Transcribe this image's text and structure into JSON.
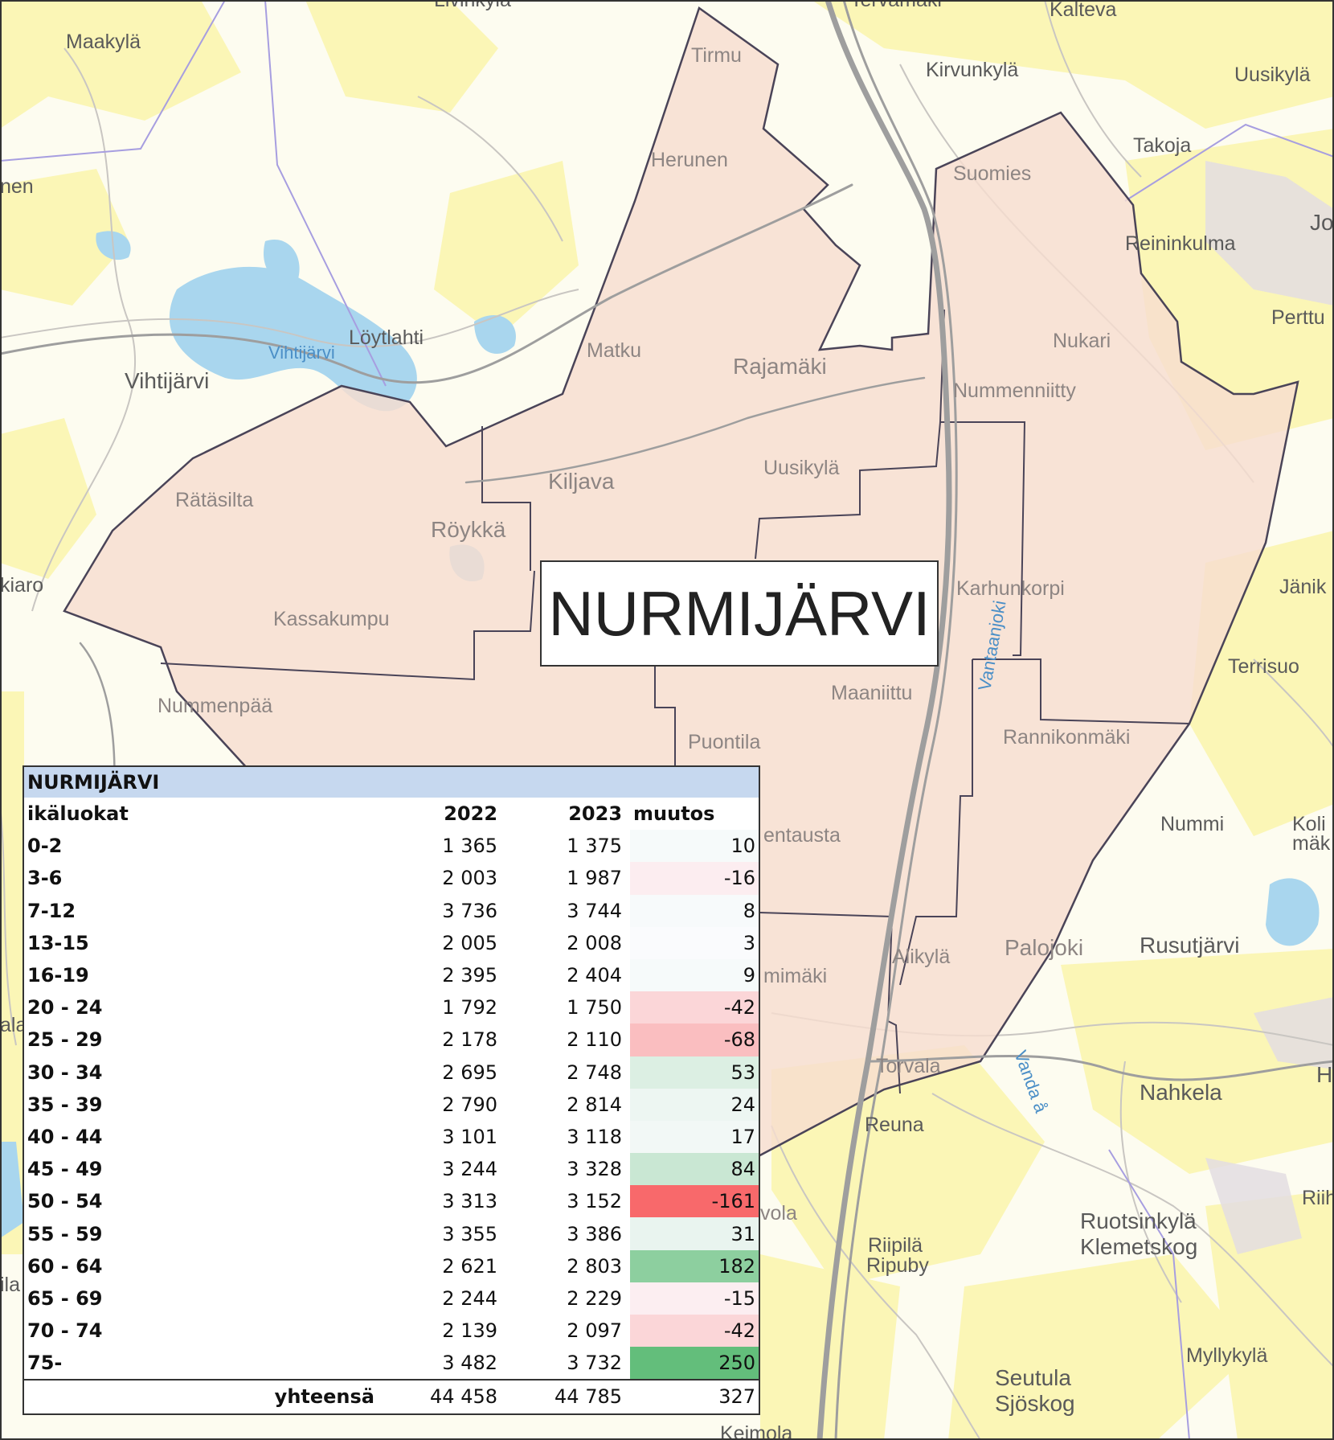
{
  "map": {
    "colors": {
      "land": "#fdfcf0",
      "open_field": "#fbf6b6",
      "water": "#a9d6ee",
      "urban": "#e3dde2",
      "road_major": "#9e9e9e",
      "region_fill": "#f6ddd0",
      "region_border": "#4a4458",
      "admin_border": "#a79ee0"
    },
    "places": [
      {
        "name": "Maakylä"
      },
      {
        "name": "Livinkylä"
      },
      {
        "name": "Tervamäki"
      },
      {
        "name": "Kalteva"
      },
      {
        "name": "Kirvunkylä"
      },
      {
        "name": "Uusikylä"
      },
      {
        "name": "Takoja"
      },
      {
        "name": "nen"
      },
      {
        "name": "Tirmu"
      },
      {
        "name": "Herunen"
      },
      {
        "name": "Suomies"
      },
      {
        "name": "Reininkulma"
      },
      {
        "name": "Jo"
      },
      {
        "name": "Perttu"
      },
      {
        "name": "Löytlahti"
      },
      {
        "name": "Vihtijärvi"
      },
      {
        "name": "Matku"
      },
      {
        "name": "Rajamäki"
      },
      {
        "name": "Nukari"
      },
      {
        "name": "Nummenniitty"
      },
      {
        "name": "Uusikylä"
      },
      {
        "name": "Kiljava"
      },
      {
        "name": "Rätäsilta"
      },
      {
        "name": "Röykkä"
      },
      {
        "name": "kiaro"
      },
      {
        "name": "Karhunkorpi"
      },
      {
        "name": "Jänik"
      },
      {
        "name": "Kassakumpu"
      },
      {
        "name": "Terrisuo"
      },
      {
        "name": "Nummenpää"
      },
      {
        "name": "Maaniittu"
      },
      {
        "name": "Puontila"
      },
      {
        "name": "Rannikonmäki"
      },
      {
        "name": "Nummi"
      },
      {
        "name": "Koli"
      },
      {
        "name": "mäk"
      },
      {
        "name": "entausta"
      },
      {
        "name": "mimäki"
      },
      {
        "name": "Alikylä"
      },
      {
        "name": "Palojoki"
      },
      {
        "name": "Rusutjärvi"
      },
      {
        "name": "Torvala"
      },
      {
        "name": "H"
      },
      {
        "name": "Nahkela"
      },
      {
        "name": "Reuna"
      },
      {
        "name": "Riih"
      },
      {
        "name": "vola"
      },
      {
        "name": "Riipilä"
      },
      {
        "name": "Ripuby"
      },
      {
        "name": "Ruotsinkylä"
      },
      {
        "name": "Klemetskog"
      },
      {
        "name": "Myllykylä"
      },
      {
        "name": "Seutula"
      },
      {
        "name": "Sjöskog"
      },
      {
        "name": "Keimola"
      },
      {
        "name": "ala"
      },
      {
        "name": "ila"
      }
    ],
    "water_labels": [
      {
        "name": "Vihtijärvi"
      },
      {
        "name": "Vantaanjoki"
      },
      {
        "name": "Vanda å"
      }
    ]
  },
  "title": "NURMIJÄRVI",
  "table": {
    "header": "NURMIJÄRVI",
    "col_label": "ikäluokat",
    "col_2022": "2022",
    "col_2023": "2023",
    "col_change": "muutos",
    "rows": [
      {
        "group": "0-2",
        "y2022": "1 365",
        "y2023": "1 375",
        "change": "10"
      },
      {
        "group": "3-6",
        "y2022": "2 003",
        "y2023": "1 987",
        "change": "-16"
      },
      {
        "group": "7-12",
        "y2022": "3 736",
        "y2023": "3 744",
        "change": "8"
      },
      {
        "group": "13-15",
        "y2022": "2 005",
        "y2023": "2 008",
        "change": "3"
      },
      {
        "group": "16-19",
        "y2022": "2 395",
        "y2023": "2 404",
        "change": "9"
      },
      {
        "group": "20 - 24",
        "y2022": "1 792",
        "y2023": "1 750",
        "change": "-42"
      },
      {
        "group": "25 - 29",
        "y2022": "2 178",
        "y2023": "2 110",
        "change": "-68"
      },
      {
        "group": "30 - 34",
        "y2022": "2 695",
        "y2023": "2 748",
        "change": "53"
      },
      {
        "group": "35 - 39",
        "y2022": "2 790",
        "y2023": "2 814",
        "change": "24"
      },
      {
        "group": "40 - 44",
        "y2022": "3 101",
        "y2023": "3 118",
        "change": "17"
      },
      {
        "group": "45 - 49",
        "y2022": "3 244",
        "y2023": "3 328",
        "change": "84"
      },
      {
        "group": "50 - 54",
        "y2022": "3 313",
        "y2023": "3 152",
        "change": "-161"
      },
      {
        "group": "55 - 59",
        "y2022": "3 355",
        "y2023": "3 386",
        "change": "31"
      },
      {
        "group": "60 - 64",
        "y2022": "2 621",
        "y2023": "2 803",
        "change": "182"
      },
      {
        "group": "65 - 69",
        "y2022": "2 244",
        "y2023": "2 229",
        "change": "-15"
      },
      {
        "group": "70 - 74",
        "y2022": "2 139",
        "y2023": "2 097",
        "change": "-42"
      },
      {
        "group": "75-",
        "y2022": "3 482",
        "y2023": "3 732",
        "change": "250"
      }
    ],
    "total_label": "yhteensä",
    "total_2022": "44 458",
    "total_2023": "44 785",
    "total_change": "327",
    "scale_colors": {
      "negative": "#f8696b",
      "neutral": "#fcfcff",
      "positive": "#63be7b"
    }
  }
}
